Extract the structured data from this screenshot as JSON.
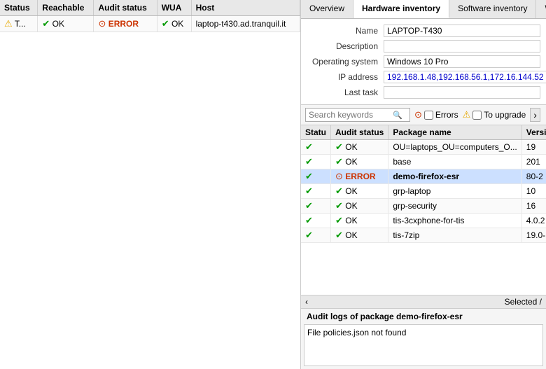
{
  "left_table": {
    "columns": [
      "Status",
      "Reachable",
      "Audit status",
      "WUA",
      "Host"
    ],
    "rows": [
      {
        "status_icon": "⚠",
        "status_text": "T...",
        "reachable_icon": "✔",
        "reachable_text": "OK",
        "audit_icon": "error",
        "audit_text": "ERROR",
        "wua_icon": "✔",
        "wua_text": "OK",
        "host": "laptop-t430.ad.tranquil.it"
      }
    ]
  },
  "tabs": [
    "Overview",
    "Hardware inventory",
    "Software inventory",
    "Windows u..."
  ],
  "active_tab": "Hardware inventory",
  "info": {
    "name_label": "Name",
    "name_value": "LAPTOP-T430",
    "description_label": "Description",
    "description_value": "",
    "os_label": "Operating system",
    "os_value": "Windows 10 Pro",
    "ip_label": "IP address",
    "ip_value": "192.168.1.48,192.168.56.1,172.16.144.52",
    "lasttask_label": "Last task",
    "lasttask_value": ""
  },
  "search": {
    "placeholder": "Search keywords"
  },
  "filters": {
    "errors_label": "Errors",
    "upgrade_label": "To upgrade"
  },
  "pkg_table": {
    "columns": [
      "Statu",
      "Audit status",
      "Package name",
      "Versio"
    ],
    "rows": [
      {
        "status": "ok",
        "audit": "ok",
        "audit_text": "OK",
        "pkg": "OU=laptops_OU=computers_O...",
        "version": "19",
        "highlighted": false
      },
      {
        "status": "ok",
        "audit": "ok",
        "audit_text": "OK",
        "pkg": "base",
        "version": "201",
        "highlighted": false
      },
      {
        "status": "ok",
        "audit": "error",
        "audit_text": "ERROR",
        "pkg": "demo-firefox-esr",
        "version": "80-2",
        "highlighted": true
      },
      {
        "status": "ok",
        "audit": "ok",
        "audit_text": "OK",
        "pkg": "grp-laptop",
        "version": "10",
        "highlighted": false
      },
      {
        "status": "ok",
        "audit": "ok",
        "audit_text": "OK",
        "pkg": "grp-security",
        "version": "16",
        "highlighted": false
      },
      {
        "status": "ok",
        "audit": "ok",
        "audit_text": "OK",
        "pkg": "tis-3cxphone-for-tis",
        "version": "4.0.2",
        "highlighted": false
      },
      {
        "status": "ok",
        "audit": "ok",
        "audit_text": "OK",
        "pkg": "tis-7zip",
        "version": "19.0-",
        "highlighted": false
      }
    ]
  },
  "scroll_hint": {
    "arrow": "›",
    "selected_text": "Selected /"
  },
  "audit_log": {
    "title": "Audit logs of package demo-firefox-esr",
    "content": "File policies.json not found"
  }
}
